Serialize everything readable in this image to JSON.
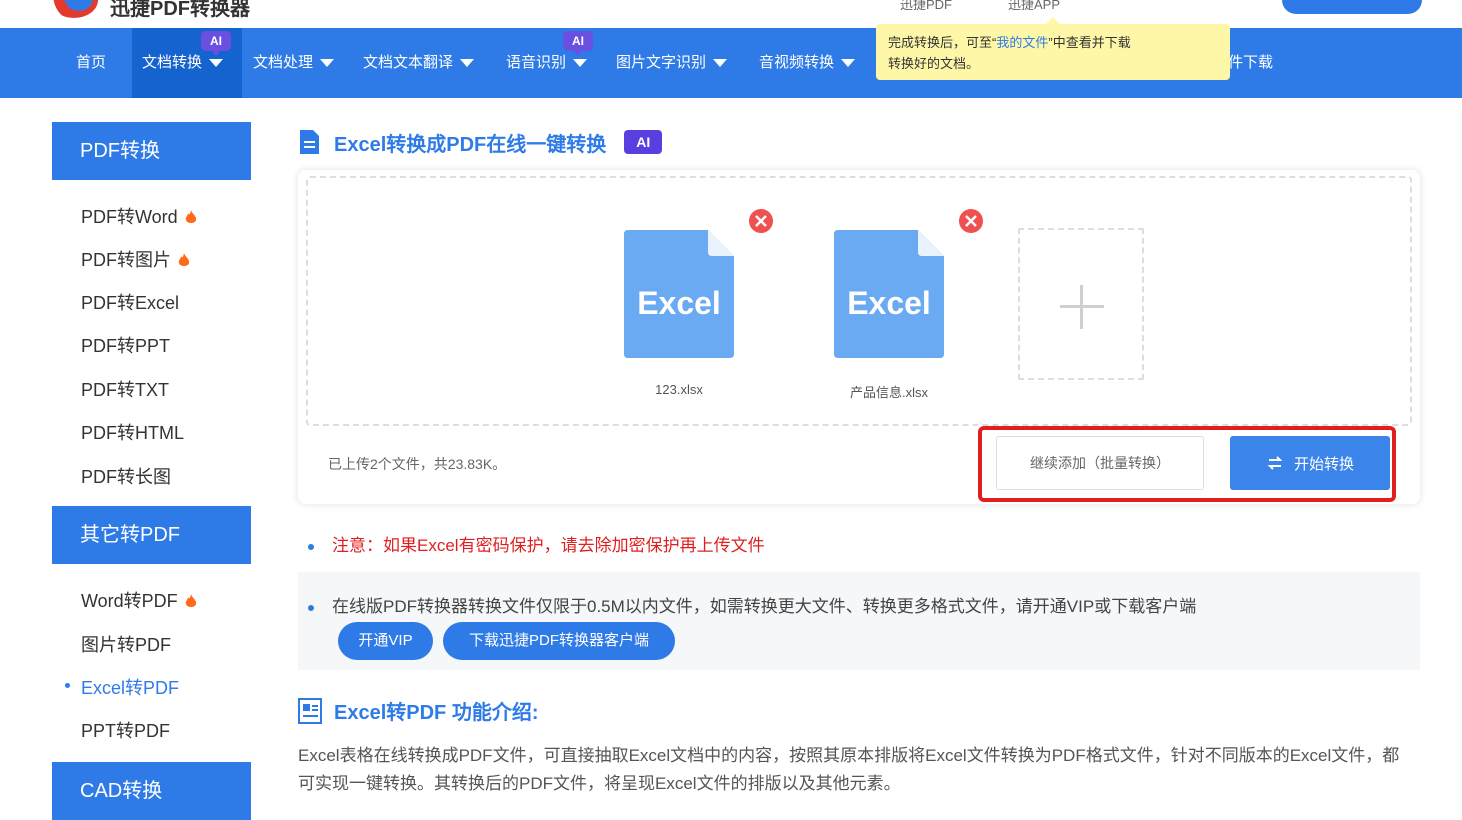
{
  "header": {
    "logo_text": "迅捷PDF转换器",
    "top_link_1": "迅捷PDF",
    "top_link_2": "迅捷APP"
  },
  "nav": {
    "items": [
      {
        "label": "首页"
      },
      {
        "label": "文档转换",
        "badge": "AI"
      },
      {
        "label": "文档处理"
      },
      {
        "label": "文档文本翻译"
      },
      {
        "label": "语音识别",
        "badge": "AI"
      },
      {
        "label": "图片文字识别"
      },
      {
        "label": "音视频转换"
      },
      {
        "label": "件下载"
      }
    ]
  },
  "tooltip": {
    "part1": "完成转换后，可至“",
    "link": "我的文件",
    "part2": "”中查看并下载",
    "line2": "转换好的文档。"
  },
  "sidebar": {
    "pdf_head": "PDF转换",
    "pdf_items": [
      "PDF转Word",
      "PDF转图片",
      "PDF转Excel",
      "PDF转PPT",
      "PDF转TXT",
      "PDF转HTML",
      "PDF转长图"
    ],
    "other_head": "其它转PDF",
    "other_items": [
      "Word转PDF",
      "图片转PDF",
      "Excel转PDF",
      "PPT转PDF"
    ],
    "cad_head": "CAD转换"
  },
  "main": {
    "title": "Excel转换成PDF在线一键转换",
    "ai_tag": "AI",
    "files": [
      {
        "icon_label": "Excel",
        "name": "123.xlsx"
      },
      {
        "icon_label": "Excel",
        "name": "产品信息.xlsx"
      }
    ],
    "upload_status": "已上传2个文件，共23.83K。",
    "add_more_label": "继续添加（批量转换）",
    "start_label": "开始转换"
  },
  "notes": {
    "warning": "注意：如果Excel有密码保护，请去除加密保护再上传文件",
    "limit": "在线版PDF转换器转换文件仅限于0.5M以内文件，如需转换更大文件、转换更多格式文件，请开通VIP或下载客户端",
    "vip_label": "开通VIP",
    "download_label": "下载迅捷PDF转换器客户端"
  },
  "intro": {
    "title": "Excel转PDF 功能介绍:",
    "text": "Excel表格在线转换成PDF文件，可直接抽取Excel文档中的内容，按照其原本排版将Excel文件转换为PDF格式文件，针对不同版本的Excel文件，都可实现一键转换。其转换后的PDF文件，将呈现Excel文件的排版以及其他元素。"
  },
  "colors": {
    "primary": "#2e7be8",
    "nav_active": "#1563cf",
    "danger": "#e02020",
    "ai_badge": "#6b4fe0",
    "tooltip_bg": "#fff7a8",
    "excel_icon": "#6aaaf2",
    "fire": "#ff6a1a"
  }
}
